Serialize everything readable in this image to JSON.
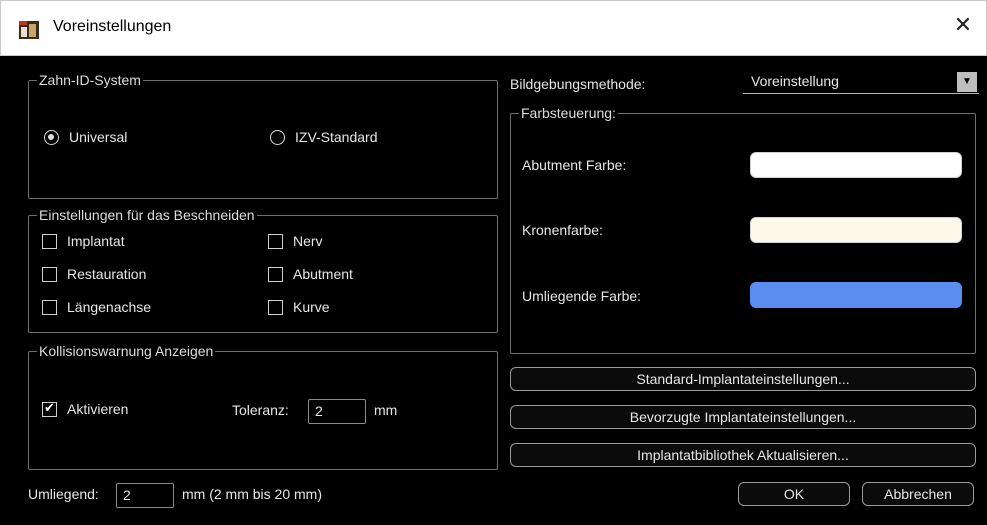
{
  "window": {
    "title": "Voreinstellungen",
    "close_glyph": "✕"
  },
  "tooth_id": {
    "group_label": "Zahn-ID-System",
    "options": [
      {
        "label": "Universal",
        "selected": true
      },
      {
        "label": "IZV-Standard",
        "selected": false
      }
    ]
  },
  "clipping": {
    "group_label": "Einstellungen für das Beschneiden",
    "items": [
      {
        "label": "Implantat",
        "checked": false
      },
      {
        "label": "Nerv",
        "checked": false
      },
      {
        "label": "Restauration",
        "checked": false
      },
      {
        "label": "Abutment",
        "checked": false
      },
      {
        "label": "Längenachse",
        "checked": false
      },
      {
        "label": "Kurve",
        "checked": false
      }
    ]
  },
  "collision": {
    "group_label": "Kollisionswarnung Anzeigen",
    "activate_label": "Aktivieren",
    "activate_checked": true,
    "check_glyph": "✔",
    "tolerance_label": "Toleranz:",
    "tolerance_value": "2",
    "tolerance_unit": "mm"
  },
  "surrounding": {
    "label": "Umliegend:",
    "value": "2",
    "hint": "mm (2 mm bis 20 mm)"
  },
  "imaging": {
    "label": "Bildgebungsmethode:",
    "selected": "Voreinstellung",
    "arrow_glyph": "▼"
  },
  "color_control": {
    "group_label": "Farbsteuerung:",
    "rows": [
      {
        "label": "Abutment Farbe:",
        "color": "#ffffff"
      },
      {
        "label": "Kronenfarbe:",
        "color": "#fdf9ea"
      },
      {
        "label": "Umliegende Farbe:",
        "color": "#5b8cf0"
      }
    ]
  },
  "buttons": {
    "standard_implant": "Standard-Implantateinstellungen...",
    "preferred_implant": "Bevorzugte Implantateinstellungen...",
    "update_library": "Implantatbibliothek Aktualisieren...",
    "ok": "OK",
    "cancel": "Abbrechen"
  }
}
